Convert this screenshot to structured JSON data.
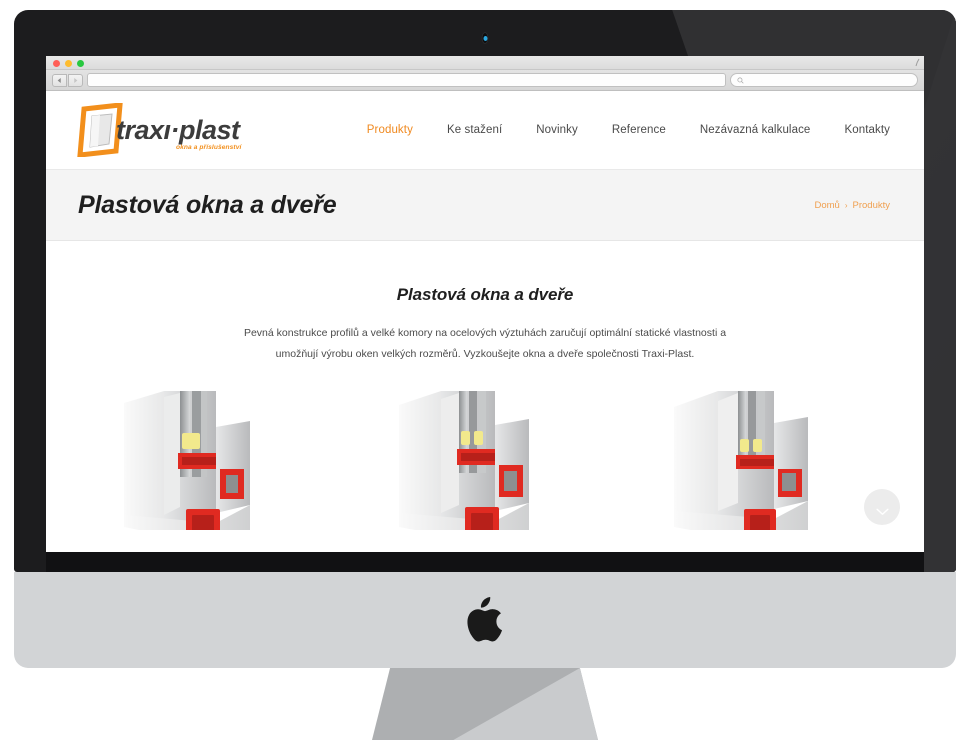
{
  "device": {
    "name": "imac-desktop-computer",
    "brand_logo": "apple-logo",
    "camera": "facetime-camera",
    "bezel_color": "#1c1c1e",
    "chin_color": "#d2d4d6"
  },
  "browser": {
    "window_controls": [
      "close",
      "minimize",
      "maximize"
    ],
    "back_label": "◀",
    "forward_label": "▶",
    "url_value": "",
    "url_placeholder": "",
    "search_value": "",
    "search_placeholder": ""
  },
  "site": {
    "brand": {
      "name": "traxı·plast",
      "tagline": "okna a příslušenství",
      "accent_color": "#f08a21"
    },
    "nav": [
      {
        "label": "Produkty",
        "active": true
      },
      {
        "label": "Ke stažení",
        "active": false
      },
      {
        "label": "Novinky",
        "active": false
      },
      {
        "label": "Reference",
        "active": false
      },
      {
        "label": "Nezávazná kalkulace",
        "active": false
      },
      {
        "label": "Kontakty",
        "active": false
      }
    ],
    "page": {
      "title": "Plastová okna a dveře",
      "breadcrumb": {
        "home": "Domů",
        "separator": "›",
        "current": "Produkty"
      }
    },
    "intro": {
      "heading": "Plastová okna a dveře",
      "paragraph": "Pevná konstrukce profilů a velké komory na ocelových výztuhách zaručují optimální statické vlastnosti a umožňují výrobu oken velkých rozměrů. Vyzkoušejte okna a dveře společnosti Traxi-Plast."
    },
    "gallery": [
      {
        "alt": "pvc-window-profile-cross-section-1",
        "glazing_blocks": 1
      },
      {
        "alt": "pvc-window-profile-cross-section-2",
        "glazing_blocks": 2
      },
      {
        "alt": "pvc-window-profile-cross-section-3",
        "glazing_blocks": 2
      }
    ],
    "scroll_down": {
      "icon": "chevron-down-icon",
      "label": ""
    }
  }
}
